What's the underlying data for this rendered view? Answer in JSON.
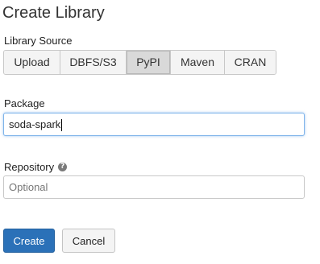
{
  "dialog": {
    "title": "Create Library"
  },
  "library_source": {
    "label": "Library Source",
    "options": [
      "Upload",
      "DBFS/S3",
      "PyPI",
      "Maven",
      "CRAN"
    ],
    "selected": "PyPI"
  },
  "package": {
    "label": "Package",
    "value": "soda-spark"
  },
  "repository": {
    "label": "Repository",
    "help_icon": "question-circle-icon",
    "placeholder": "Optional",
    "value": ""
  },
  "actions": {
    "create_label": "Create",
    "cancel_label": "Cancel"
  },
  "colors": {
    "primary": "#2b71b8",
    "focus_border": "#7fb4ea",
    "selected_segment": "#d9d9d9"
  }
}
